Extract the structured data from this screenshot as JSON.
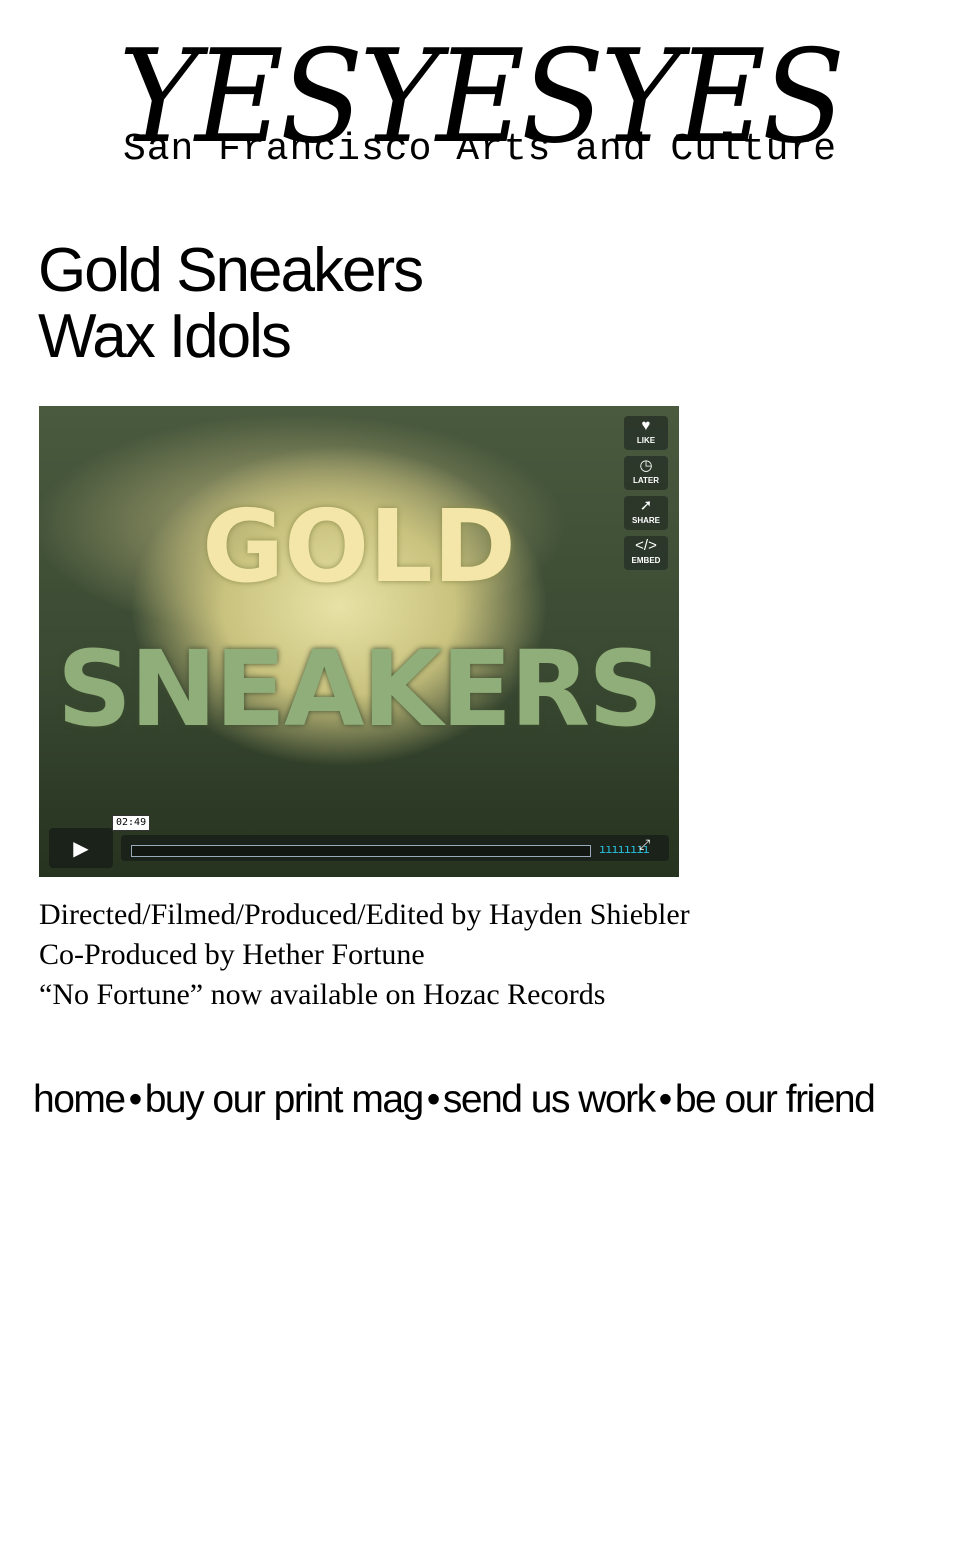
{
  "header": {
    "logo": "YESYESYES",
    "tagline": "San Francisco Arts and Culture"
  },
  "post": {
    "title": "Gold Sneakers",
    "artist": "Wax Idols"
  },
  "video": {
    "overlay_line1": "GOLD",
    "overlay_line2": "SNEAKERS",
    "side_buttons": [
      {
        "label": "LIKE",
        "icon": "heart-icon"
      },
      {
        "label": "LATER",
        "icon": "clock-icon"
      },
      {
        "label": "SHARE",
        "icon": "share-icon"
      },
      {
        "label": "EMBED",
        "icon": "embed-icon"
      }
    ],
    "duration": "02:49",
    "progress": 0.0
  },
  "credits": [
    "Directed/Filmed/Produced/Edited by Hayden Shiebler",
    "Co-Produced by Hether Fortune",
    "“No Fortune” now available on Hozac Records"
  ],
  "nav": {
    "items": [
      "home",
      "buy our print mag",
      "send us work",
      "be our friend"
    ],
    "separator": "•"
  }
}
